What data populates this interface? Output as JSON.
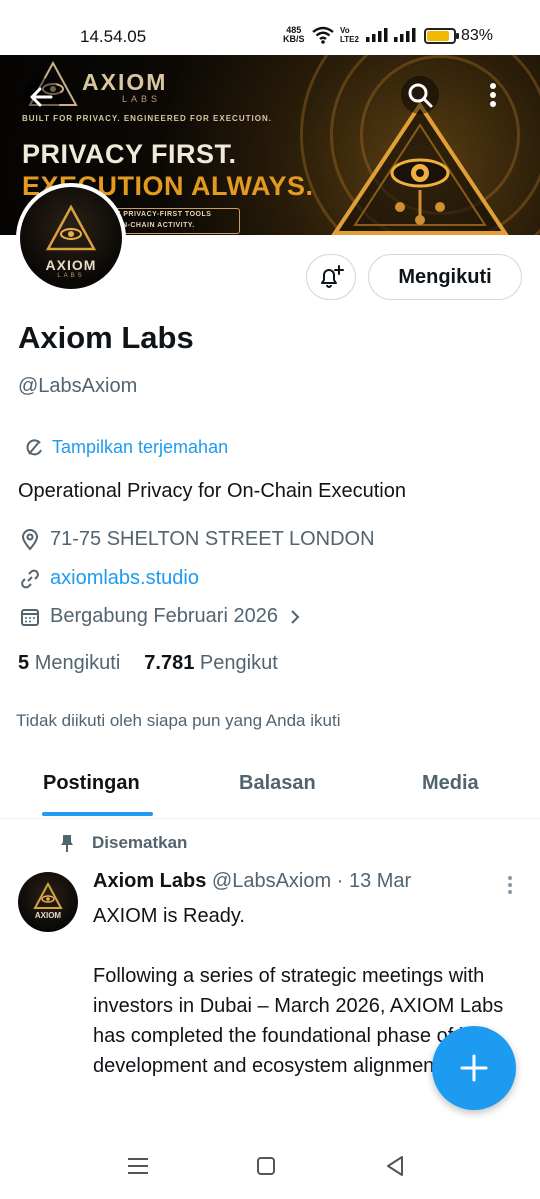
{
  "status_bar": {
    "time": "14.54.05",
    "net_speed_value": "485",
    "net_speed_unit": "KB/S",
    "volte_top": "Vo",
    "volte_bottom": "LTE2",
    "battery_percent": "83%",
    "battery_level": 0.83,
    "battery_color": "#f5b800"
  },
  "banner": {
    "brand": "AXIOM",
    "brand_sub": "LABS",
    "tagline": "BUILT FOR PRIVACY. ENGINEERED FOR EXECUTION.",
    "headline_line1": "PRIVACY FIRST.",
    "headline_line2": "EXECUTION ALWAYS.",
    "box_line1": "F PRIVACY-FIRST TOOLS",
    "box_line2": "ON-CHAIN ACTIVITY.",
    "back_icon": "arrow-left-icon",
    "search_icon": "search-icon",
    "more_icon": "more-vertical-icon"
  },
  "avatar": {
    "label": "AXIOM",
    "sub": "LABS"
  },
  "actions": {
    "notify_icon": "bell-plus-icon",
    "follow_label": "Mengikuti"
  },
  "profile": {
    "name": "Axiom Labs",
    "handle": "@LabsAxiom",
    "translate_label": "Tampilkan terjemahan",
    "bio": "Operational Privacy for On-Chain Execution",
    "location": "71-75 SHELTON STREET LONDON",
    "website": "axiomlabs.studio",
    "joined": "Bergabung Februari 2026",
    "following_count": "5",
    "following_label": "Mengikuti",
    "followers_count": "7.781",
    "followers_label": "Pengikut",
    "not_followed_note": "Tidak diikuti oleh siapa pun yang Anda ikuti"
  },
  "tabs": [
    {
      "label": "Postingan",
      "active": true
    },
    {
      "label": "Balasan",
      "active": false
    },
    {
      "label": "Media",
      "active": false
    }
  ],
  "post": {
    "pinned_label": "Disematkan",
    "author_name": "Axiom Labs",
    "author_handle": "@LabsAxiom",
    "date": "· 13 Mar",
    "avatar_label": "AXIOM",
    "text": "AXIOM is Ready.\n\nFollowing a series of strategic meetings with investors in Dubai – March 2026, AXIOM Labs has completed the foundational phase of its development and ecosystem alignment."
  },
  "fab": {
    "icon": "plus-icon",
    "color": "#1d9bf0"
  },
  "colors": {
    "accent": "#1d9bf0",
    "text_primary": "#0f1419",
    "text_secondary": "#536471",
    "banner_gold": "#e49a1e"
  }
}
